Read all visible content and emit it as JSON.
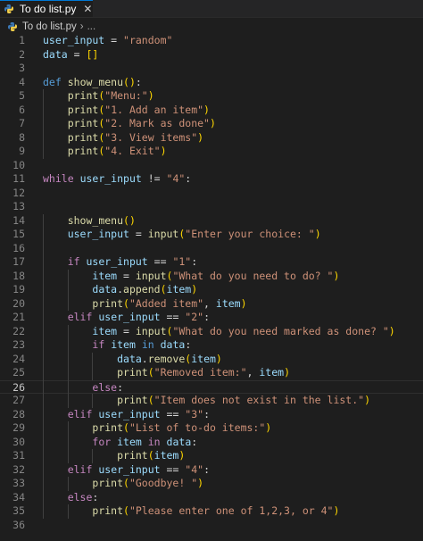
{
  "tab": {
    "label": "To do list.py",
    "close": "✕"
  },
  "breadcrumb": {
    "file": "To do list.py",
    "separator": "›",
    "more": "..."
  },
  "colors": {
    "background": "#1e1e1e",
    "keyword": "#569cd6",
    "control": "#c586c0",
    "function": "#dcdcaa",
    "string": "#ce9178",
    "variable": "#9cdcfe",
    "bracket1": "#ffd700",
    "bracket2": "#da70d6",
    "line_number": "#858585"
  },
  "icons": {
    "file_type": "python-icon",
    "close": "close-icon"
  },
  "current_line": 26,
  "lines": [
    {
      "n": "1",
      "t": [
        [
          "var",
          "user_input"
        ],
        [
          "op",
          " = "
        ],
        [
          "str",
          "\"random\""
        ]
      ]
    },
    {
      "n": "2",
      "t": [
        [
          "var",
          "data"
        ],
        [
          "op",
          " = "
        ],
        [
          "p1",
          "[]"
        ]
      ]
    },
    {
      "n": "3",
      "t": []
    },
    {
      "n": "4",
      "t": [
        [
          "kw",
          "def"
        ],
        [
          "op",
          " "
        ],
        [
          "fn",
          "show_menu"
        ],
        [
          "p1",
          "()"
        ],
        [
          "op",
          ":"
        ]
      ]
    },
    {
      "n": "5",
      "t": [
        [
          "op",
          "    "
        ],
        [
          "fn",
          "print"
        ],
        [
          "p1",
          "("
        ],
        [
          "str",
          "\"Menu:\""
        ],
        [
          "p1",
          ")"
        ]
      ]
    },
    {
      "n": "6",
      "t": [
        [
          "op",
          "    "
        ],
        [
          "fn",
          "print"
        ],
        [
          "p1",
          "("
        ],
        [
          "str",
          "\"1. Add an item\""
        ],
        [
          "p1",
          ")"
        ]
      ]
    },
    {
      "n": "7",
      "t": [
        [
          "op",
          "    "
        ],
        [
          "fn",
          "print"
        ],
        [
          "p1",
          "("
        ],
        [
          "str",
          "\"2. Mark as done\""
        ],
        [
          "p1",
          ")"
        ]
      ]
    },
    {
      "n": "8",
      "t": [
        [
          "op",
          "    "
        ],
        [
          "fn",
          "print"
        ],
        [
          "p1",
          "("
        ],
        [
          "str",
          "\"3. View items\""
        ],
        [
          "p1",
          ")"
        ]
      ]
    },
    {
      "n": "9",
      "t": [
        [
          "op",
          "    "
        ],
        [
          "fn",
          "print"
        ],
        [
          "p1",
          "("
        ],
        [
          "str",
          "\"4. Exit\""
        ],
        [
          "p1",
          ")"
        ]
      ]
    },
    {
      "n": "10",
      "t": []
    },
    {
      "n": "11",
      "t": [
        [
          "ctl",
          "while"
        ],
        [
          "op",
          " "
        ],
        [
          "var",
          "user_input"
        ],
        [
          "op",
          " != "
        ],
        [
          "str",
          "\"4\""
        ],
        [
          "op",
          ":"
        ]
      ]
    },
    {
      "n": "12",
      "t": []
    },
    {
      "n": "13",
      "t": []
    },
    {
      "n": "14",
      "t": [
        [
          "op",
          "    "
        ],
        [
          "fn",
          "show_menu"
        ],
        [
          "p1",
          "()"
        ]
      ]
    },
    {
      "n": "15",
      "t": [
        [
          "op",
          "    "
        ],
        [
          "var",
          "user_input"
        ],
        [
          "op",
          " = "
        ],
        [
          "fn",
          "input"
        ],
        [
          "p1",
          "("
        ],
        [
          "str",
          "\"Enter your choice: \""
        ],
        [
          "p1",
          ")"
        ]
      ]
    },
    {
      "n": "16",
      "t": []
    },
    {
      "n": "17",
      "t": [
        [
          "op",
          "    "
        ],
        [
          "ctl",
          "if"
        ],
        [
          "op",
          " "
        ],
        [
          "var",
          "user_input"
        ],
        [
          "op",
          " == "
        ],
        [
          "str",
          "\"1\""
        ],
        [
          "op",
          ":"
        ]
      ]
    },
    {
      "n": "18",
      "t": [
        [
          "op",
          "        "
        ],
        [
          "var",
          "item"
        ],
        [
          "op",
          " = "
        ],
        [
          "fn",
          "input"
        ],
        [
          "p1",
          "("
        ],
        [
          "str",
          "\"What do you need to do? \""
        ],
        [
          "p1",
          ")"
        ]
      ]
    },
    {
      "n": "19",
      "t": [
        [
          "op",
          "        "
        ],
        [
          "var",
          "data"
        ],
        [
          "op",
          "."
        ],
        [
          "fn",
          "append"
        ],
        [
          "p1",
          "("
        ],
        [
          "var",
          "item"
        ],
        [
          "p1",
          ")"
        ]
      ]
    },
    {
      "n": "20",
      "t": [
        [
          "op",
          "        "
        ],
        [
          "fn",
          "print"
        ],
        [
          "p1",
          "("
        ],
        [
          "str",
          "\"Added item\""
        ],
        [
          "op",
          ", "
        ],
        [
          "var",
          "item"
        ],
        [
          "p1",
          ")"
        ]
      ]
    },
    {
      "n": "21",
      "t": [
        [
          "op",
          "    "
        ],
        [
          "ctl",
          "elif"
        ],
        [
          "op",
          " "
        ],
        [
          "var",
          "user_input"
        ],
        [
          "op",
          " == "
        ],
        [
          "str",
          "\"2\""
        ],
        [
          "op",
          ":"
        ]
      ]
    },
    {
      "n": "22",
      "t": [
        [
          "op",
          "        "
        ],
        [
          "var",
          "item"
        ],
        [
          "op",
          " = "
        ],
        [
          "fn",
          "input"
        ],
        [
          "p1",
          "("
        ],
        [
          "str",
          "\"What do you need marked as done? \""
        ],
        [
          "p1",
          ")"
        ]
      ]
    },
    {
      "n": "23",
      "t": [
        [
          "op",
          "        "
        ],
        [
          "ctl",
          "if"
        ],
        [
          "op",
          " "
        ],
        [
          "var",
          "item"
        ],
        [
          "op",
          " "
        ],
        [
          "kw",
          "in"
        ],
        [
          "op",
          " "
        ],
        [
          "var",
          "data"
        ],
        [
          "op",
          ":"
        ]
      ]
    },
    {
      "n": "24",
      "t": [
        [
          "op",
          "            "
        ],
        [
          "var",
          "data"
        ],
        [
          "op",
          "."
        ],
        [
          "fn",
          "remove"
        ],
        [
          "p1",
          "("
        ],
        [
          "var",
          "item"
        ],
        [
          "p1",
          ")"
        ]
      ]
    },
    {
      "n": "25",
      "t": [
        [
          "op",
          "            "
        ],
        [
          "fn",
          "print"
        ],
        [
          "p1",
          "("
        ],
        [
          "str",
          "\"Removed item:\""
        ],
        [
          "op",
          ", "
        ],
        [
          "var",
          "item"
        ],
        [
          "p1",
          ")"
        ]
      ]
    },
    {
      "n": "26",
      "t": [
        [
          "op",
          "        "
        ],
        [
          "ctl",
          "else"
        ],
        [
          "op",
          ":"
        ]
      ]
    },
    {
      "n": "27",
      "t": [
        [
          "op",
          "            "
        ],
        [
          "fn",
          "print"
        ],
        [
          "p1",
          "("
        ],
        [
          "str",
          "\"Item does not exist in the list.\""
        ],
        [
          "p1",
          ")"
        ]
      ]
    },
    {
      "n": "28",
      "t": [
        [
          "op",
          "    "
        ],
        [
          "ctl",
          "elif"
        ],
        [
          "op",
          " "
        ],
        [
          "var",
          "user_input"
        ],
        [
          "op",
          " == "
        ],
        [
          "str",
          "\"3\""
        ],
        [
          "op",
          ":"
        ]
      ]
    },
    {
      "n": "29",
      "t": [
        [
          "op",
          "        "
        ],
        [
          "fn",
          "print"
        ],
        [
          "p1",
          "("
        ],
        [
          "str",
          "\"List of to-do items:\""
        ],
        [
          "p1",
          ")"
        ]
      ]
    },
    {
      "n": "30",
      "t": [
        [
          "op",
          "        "
        ],
        [
          "ctl",
          "for"
        ],
        [
          "op",
          " "
        ],
        [
          "var",
          "item"
        ],
        [
          "op",
          " "
        ],
        [
          "ctl",
          "in"
        ],
        [
          "op",
          " "
        ],
        [
          "var",
          "data"
        ],
        [
          "op",
          ":"
        ]
      ]
    },
    {
      "n": "31",
      "t": [
        [
          "op",
          "            "
        ],
        [
          "fn",
          "print"
        ],
        [
          "p1",
          "("
        ],
        [
          "var",
          "item"
        ],
        [
          "p1",
          ")"
        ]
      ]
    },
    {
      "n": "32",
      "t": [
        [
          "op",
          "    "
        ],
        [
          "ctl",
          "elif"
        ],
        [
          "op",
          " "
        ],
        [
          "var",
          "user_input"
        ],
        [
          "op",
          " == "
        ],
        [
          "str",
          "\"4\""
        ],
        [
          "op",
          ":"
        ]
      ]
    },
    {
      "n": "33",
      "t": [
        [
          "op",
          "        "
        ],
        [
          "fn",
          "print"
        ],
        [
          "p1",
          "("
        ],
        [
          "str",
          "\"Goodbye! \""
        ],
        [
          "p1",
          ")"
        ]
      ]
    },
    {
      "n": "34",
      "t": [
        [
          "op",
          "    "
        ],
        [
          "ctl",
          "else"
        ],
        [
          "op",
          ":"
        ]
      ]
    },
    {
      "n": "35",
      "t": [
        [
          "op",
          "        "
        ],
        [
          "fn",
          "print"
        ],
        [
          "p1",
          "("
        ],
        [
          "str",
          "\"Please enter one of 1,2,3, or 4\""
        ],
        [
          "p1",
          ")"
        ]
      ]
    },
    {
      "n": "36",
      "t": []
    }
  ]
}
